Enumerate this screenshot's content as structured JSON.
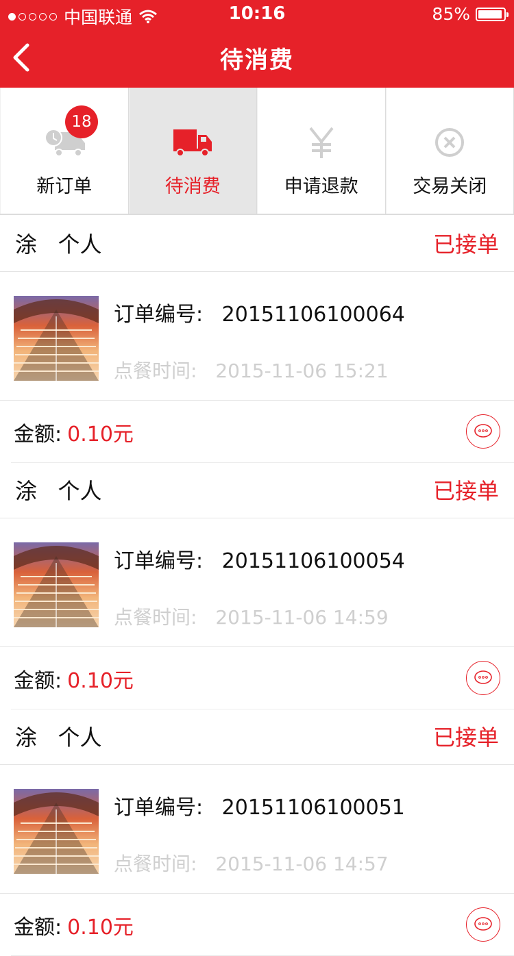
{
  "status_bar": {
    "carrier": "中国联通",
    "time": "10:16",
    "battery": "85%"
  },
  "nav": {
    "title": "待消费"
  },
  "tabs": [
    {
      "label": "新订单",
      "icon": "truck-clock-icon",
      "badge": "18",
      "active": false
    },
    {
      "label": "待消费",
      "icon": "truck-icon",
      "active": true
    },
    {
      "label": "申请退款",
      "icon": "yen-icon",
      "active": false
    },
    {
      "label": "交易关闭",
      "icon": "close-circle-icon",
      "active": false
    }
  ],
  "colors": {
    "accent": "#e62129",
    "active_tab_bg": "#e6e6e6",
    "muted_text": "#cfcfcf"
  },
  "orders": [
    {
      "customer": "涂   个人",
      "status": "已接单",
      "order_no_label": "订单编号:",
      "order_no": "20151106100064",
      "time_label": "点餐时间:",
      "time": "2015-11-06 15:21",
      "amount_label": "金额:",
      "amount": "0.10元"
    },
    {
      "customer": "涂   个人",
      "status": "已接单",
      "order_no_label": "订单编号:",
      "order_no": "20151106100054",
      "time_label": "点餐时间:",
      "time": "2015-11-06 14:59",
      "amount_label": "金额:",
      "amount": "0.10元"
    },
    {
      "customer": "涂   个人",
      "status": "已接单",
      "order_no_label": "订单编号:",
      "order_no": "20151106100051",
      "time_label": "点餐时间:",
      "time": "2015-11-06 14:57",
      "amount_label": "金额:",
      "amount": "0.10元"
    }
  ]
}
